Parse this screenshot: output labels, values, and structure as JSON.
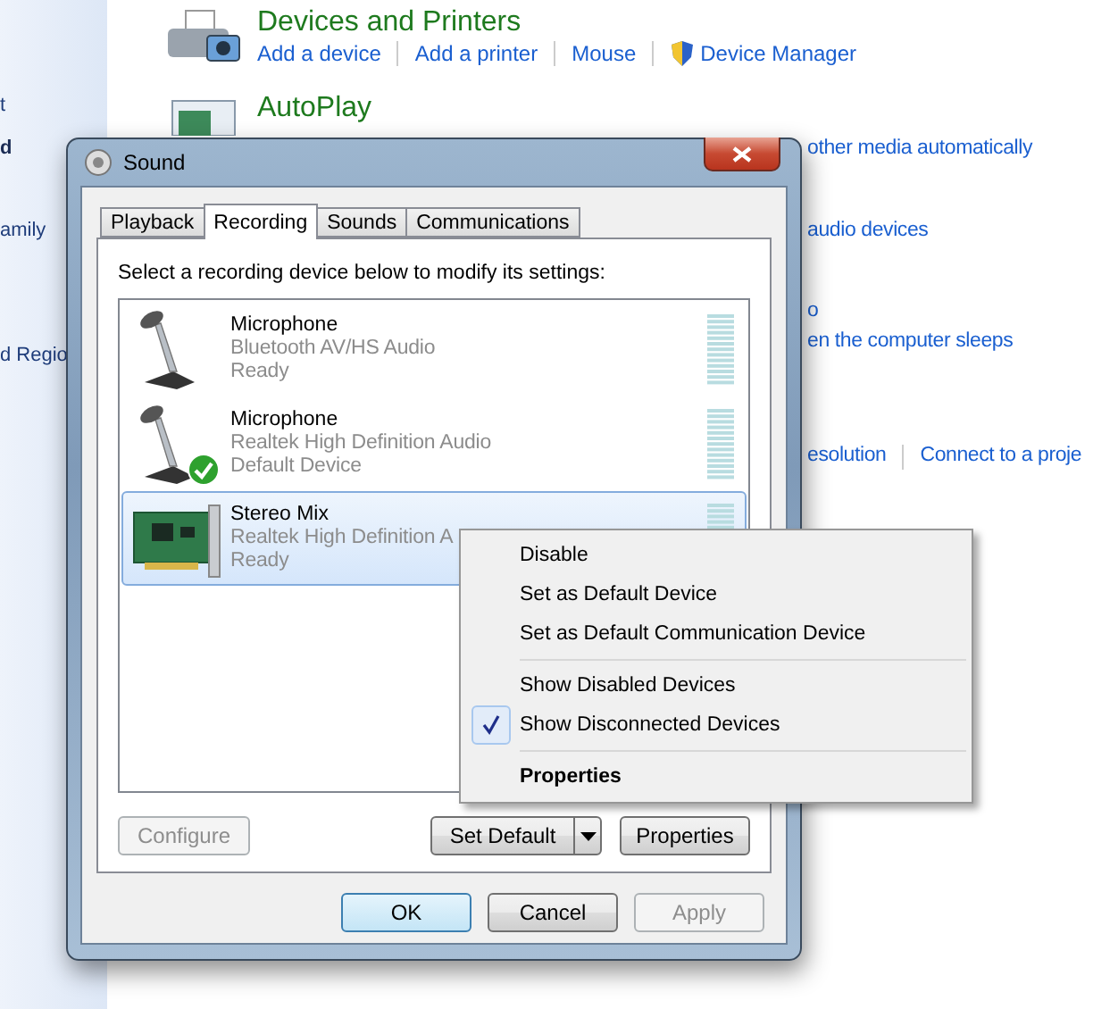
{
  "sidebar": {
    "items": [
      {
        "label": "t",
        "kind": "link"
      },
      {
        "label": "d",
        "kind": "current"
      },
      {
        "label": "amily",
        "kind": "link"
      },
      {
        "label": "d Regio",
        "kind": "link"
      }
    ]
  },
  "sections": [
    {
      "title": "Devices and Printers",
      "links": [
        {
          "label": "Add a device",
          "shield": false
        },
        {
          "label": "Add a printer",
          "shield": false
        },
        {
          "label": "Mouse",
          "shield": false
        },
        {
          "label": "Device Manager",
          "shield": true
        }
      ]
    },
    {
      "title": "AutoPlay"
    }
  ],
  "hidden_links": [
    [
      "other media automatically"
    ],
    [
      "audio devices"
    ],
    [
      "o"
    ],
    [
      "en the computer sleeps"
    ],
    [
      "esolution",
      "Connect to a proje"
    ]
  ],
  "dialog": {
    "title": "Sound",
    "tabs": [
      {
        "label": "Playback",
        "selected": false
      },
      {
        "label": "Recording",
        "selected": true
      },
      {
        "label": "Sounds",
        "selected": false
      },
      {
        "label": "Communications",
        "selected": false
      }
    ],
    "instruction": "Select a recording device below to modify its settings:",
    "devices": [
      {
        "name": "Microphone",
        "driver": "Bluetooth AV/HS Audio",
        "status": "Ready",
        "kind": "microphone",
        "default": false,
        "selected": false
      },
      {
        "name": "Microphone",
        "driver": "Realtek High Definition Audio",
        "status": "Default Device",
        "kind": "microphone",
        "default": true,
        "selected": false
      },
      {
        "name": "Stereo Mix",
        "driver": "Realtek High Definition A",
        "status": "Ready",
        "kind": "card",
        "default": false,
        "selected": true
      }
    ],
    "configure": {
      "label": "Configure",
      "disabled": true
    },
    "set_default": {
      "label": "Set Default",
      "disabled": false
    },
    "properties": {
      "label": "Properties",
      "disabled": false
    },
    "buttons": [
      {
        "label": "OK",
        "disabled": false,
        "focused": true
      },
      {
        "label": "Cancel",
        "disabled": false,
        "focused": false
      },
      {
        "label": "Apply",
        "disabled": true,
        "focused": false
      }
    ]
  },
  "context_menu": {
    "groups": [
      [
        {
          "label": "Disable",
          "checked": false,
          "default": false
        },
        {
          "label": "Set as Default Device",
          "checked": false,
          "default": false
        },
        {
          "label": "Set as Default Communication Device",
          "checked": false,
          "default": false
        }
      ],
      [
        {
          "label": "Show Disabled Devices",
          "checked": false,
          "default": false
        },
        {
          "label": "Show Disconnected Devices",
          "checked": true,
          "default": false
        }
      ],
      [
        {
          "label": "Properties",
          "checked": false,
          "default": true
        }
      ]
    ]
  }
}
